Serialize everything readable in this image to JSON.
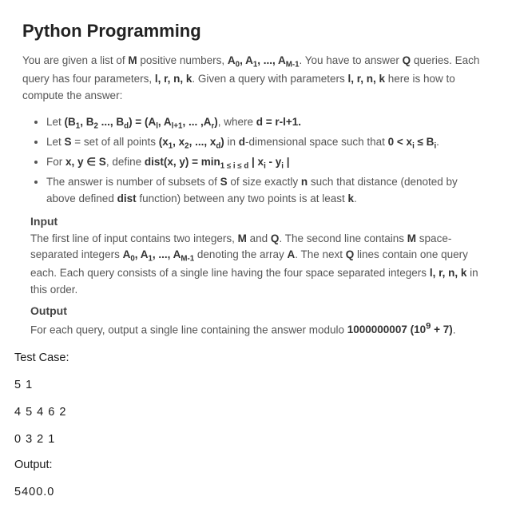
{
  "title": "Python Programming",
  "intro_html": "You are given a list of <b>M</b> positive numbers, <b>A<sub>0</sub>, A<sub>1</sub>, ..., A<sub>M-1</sub></b>. You have to answer <b>Q</b> queries. Each query has four parameters, <b>l, r, n, k</b>. Given a query with parameters <b>l, r, n, k</b> here is how to compute the answer:",
  "bullets_html": [
    "Let <b>(B<sub>1</sub>, B<sub>2</sub> ..., B<sub>d</sub>) = (A<sub>l</sub>, A<sub>l+1</sub>, ... ,A<sub>r</sub>)</b>, where <b>d = r-l+1.</b>",
    "Let <b>S</b> = set of all points <b>(x<sub>1</sub>, x<sub>2</sub>, ..., x<sub>d</sub>)</b> in <b>d</b>-dimensional space such that <b>0 &lt; x<sub>i</sub> ≤ B<sub>i</sub></b>.",
    "For <b>x, y ∈ S</b>, define <b>dist(x, y) = min<sub>1 ≤ i ≤ d</sub> | x<sub>i</sub> - y<sub>i</sub> |</b>",
    "The answer is number of subsets of <b>S</b> of size exactly <b>n</b> such that distance (denoted by above defined <b>dist</b> function) between any two points is at least <b>k</b>."
  ],
  "input_head": "Input",
  "input_body_html": "The first line of input contains two integers, <b>M</b> and <b>Q</b>. The second line contains <b>M</b> space-separated integers <b>A<sub>0</sub>, A<sub>1</sub>, ..., A<sub>M-1</sub></b> denoting the array <b>A</b>. The next <b>Q</b> lines contain one query each. Each query consists of a single line having the four space separated integers <b>l, r, n, k</b> in this order.",
  "output_head": "Output",
  "output_body_html": "For each query, output a single line containing the answer modulo <b>1000000007 (10<sup>9</sup> + 7)</b>.",
  "testcase_label": "Test Case:",
  "tc_lines": [
    "5 1",
    "4 5 4 6 2",
    "0 3 2 1"
  ],
  "output_label": "Output:",
  "output_value": "5400.0"
}
